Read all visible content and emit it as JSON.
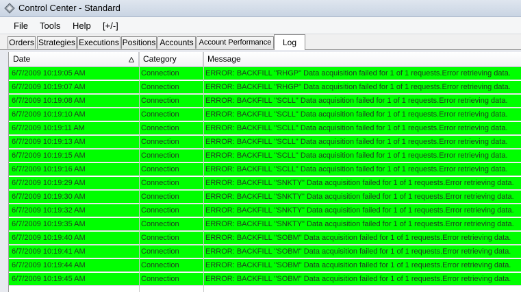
{
  "window": {
    "title": "Control Center - Standard"
  },
  "menu": [
    "File",
    "Tools",
    "Help",
    "[+/-]"
  ],
  "tabs": [
    "Orders",
    "Strategies",
    "Executions",
    "Positions",
    "Accounts",
    "Account Performance",
    "Log"
  ],
  "active_tab": "Log",
  "grid": {
    "columns": [
      "Date",
      "Category",
      "Message"
    ],
    "sorted_column": "Date",
    "sort_direction": "ascending",
    "row_color": "#00ff00",
    "rows": [
      {
        "date": "6/7/2009 10:19:05 AM",
        "category": "Connection",
        "message": "ERROR: BACKFILL \"RHGP\" Data acquisition failed for 1 of 1 requests.Error retrieving data."
      },
      {
        "date": "6/7/2009 10:19:07 AM",
        "category": "Connection",
        "message": "ERROR: BACKFILL \"RHGP\" Data acquisition failed for 1 of 1 requests.Error retrieving data."
      },
      {
        "date": "6/7/2009 10:19:08 AM",
        "category": "Connection",
        "message": "ERROR: BACKFILL \"SCLL\" Data acquisition failed for 1 of 1 requests.Error retrieving data."
      },
      {
        "date": "6/7/2009 10:19:10 AM",
        "category": "Connection",
        "message": "ERROR: BACKFILL \"SCLL\" Data acquisition failed for 1 of 1 requests.Error retrieving data."
      },
      {
        "date": "6/7/2009 10:19:11 AM",
        "category": "Connection",
        "message": "ERROR: BACKFILL \"SCLL\" Data acquisition failed for 1 of 1 requests.Error retrieving data."
      },
      {
        "date": "6/7/2009 10:19:13 AM",
        "category": "Connection",
        "message": "ERROR: BACKFILL \"SCLL\" Data acquisition failed for 1 of 1 requests.Error retrieving data."
      },
      {
        "date": "6/7/2009 10:19:15 AM",
        "category": "Connection",
        "message": "ERROR: BACKFILL \"SCLL\" Data acquisition failed for 1 of 1 requests.Error retrieving data."
      },
      {
        "date": "6/7/2009 10:19:16 AM",
        "category": "Connection",
        "message": "ERROR: BACKFILL \"SCLL\" Data acquisition failed for 1 of 1 requests.Error retrieving data."
      },
      {
        "date": "6/7/2009 10:19:29 AM",
        "category": "Connection",
        "message": "ERROR: BACKFILL \"SNKTY\" Data acquisition failed for 1 of 1 requests.Error retrieving data."
      },
      {
        "date": "6/7/2009 10:19:30 AM",
        "category": "Connection",
        "message": "ERROR: BACKFILL \"SNKTY\" Data acquisition failed for 1 of 1 requests.Error retrieving data."
      },
      {
        "date": "6/7/2009 10:19:32 AM",
        "category": "Connection",
        "message": "ERROR: BACKFILL \"SNKTY\" Data acquisition failed for 1 of 1 requests.Error retrieving data."
      },
      {
        "date": "6/7/2009 10:19:35 AM",
        "category": "Connection",
        "message": "ERROR: BACKFILL \"SNKTY\" Data acquisition failed for 1 of 1 requests.Error retrieving data."
      },
      {
        "date": "6/7/2009 10:19:40 AM",
        "category": "Connection",
        "message": "ERROR: BACKFILL \"SOBM\" Data acquisition failed for 1 of 1 requests.Error retrieving data."
      },
      {
        "date": "6/7/2009 10:19:41 AM",
        "category": "Connection",
        "message": "ERROR: BACKFILL \"SOBM\" Data acquisition failed for 1 of 1 requests.Error retrieving data."
      },
      {
        "date": "6/7/2009 10:19:44 AM",
        "category": "Connection",
        "message": "ERROR: BACKFILL \"SOBM\" Data acquisition failed for 1 of 1 requests.Error retrieving data."
      },
      {
        "date": "6/7/2009 10:19:45 AM",
        "category": "Connection",
        "message": "ERROR: BACKFILL \"SOBM\" Data acquisition failed for 1 of 1 requests.Error retrieving data."
      }
    ]
  }
}
